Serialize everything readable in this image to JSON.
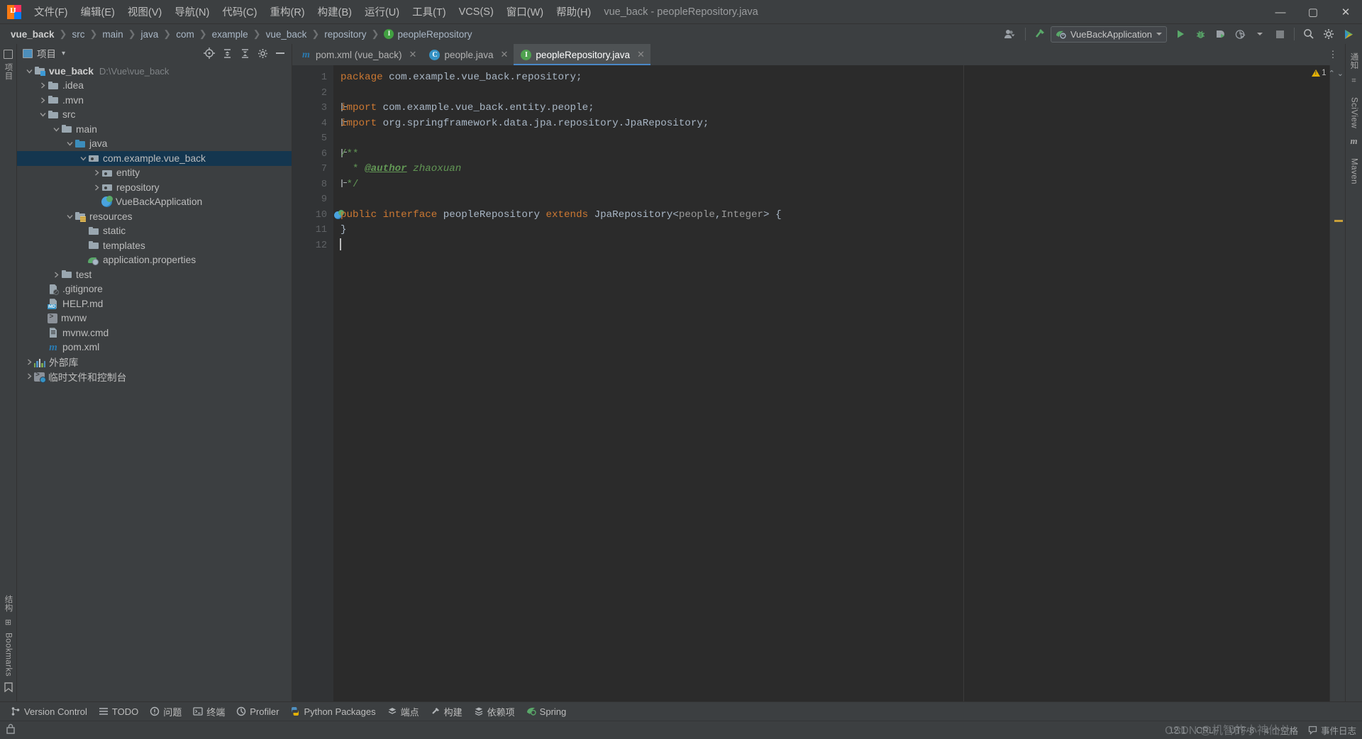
{
  "window": {
    "title": "vue_back - peopleRepository.java",
    "logo_text": "IJ",
    "minimize": "—",
    "maximize": "▢",
    "close": "✕"
  },
  "menu": [
    {
      "label": "文件(F)",
      "name": "menu-file"
    },
    {
      "label": "编辑(E)",
      "name": "menu-edit"
    },
    {
      "label": "视图(V)",
      "name": "menu-view"
    },
    {
      "label": "导航(N)",
      "name": "menu-navigate"
    },
    {
      "label": "代码(C)",
      "name": "menu-code"
    },
    {
      "label": "重构(R)",
      "name": "menu-refactor"
    },
    {
      "label": "构建(B)",
      "name": "menu-build"
    },
    {
      "label": "运行(U)",
      "name": "menu-run"
    },
    {
      "label": "工具(T)",
      "name": "menu-tools"
    },
    {
      "label": "VCS(S)",
      "name": "menu-vcs"
    },
    {
      "label": "窗口(W)",
      "name": "menu-window"
    },
    {
      "label": "帮助(H)",
      "name": "menu-help"
    }
  ],
  "breadcrumb": {
    "separator": "❯",
    "items": [
      "vue_back",
      "src",
      "main",
      "java",
      "com",
      "example",
      "vue_back",
      "repository",
      "peopleRepository"
    ],
    "last_icon": "I"
  },
  "toolbar": {
    "account_icon": "user-dropdown",
    "build_icon": "hammer-icon",
    "run_config": "VueBackApplication",
    "run_label": "run-button",
    "debug_label": "debug-button",
    "coverage_label": "coverage-button",
    "profiler_label": "profiler-button",
    "stop_label": "stop-button",
    "search_icon": "🔍",
    "settings_icon": "⚙",
    "updates_icon": "updates-icon"
  },
  "left_strip": {
    "project_vtext": "项目",
    "structure_vtext": "结构",
    "bookmarks_vtext": "Bookmarks"
  },
  "right_strip": {
    "notifications_vtext": "通知",
    "sciview_vtext": "SciView",
    "maven_vtext": "Maven",
    "maven_glyph": "m"
  },
  "project_panel": {
    "title": "项目",
    "dropdown": "▾",
    "actions": [
      "select-opened-file-icon",
      "expand-all-icon",
      "collapse-all-icon",
      "settings-icon",
      "hide-icon"
    ],
    "tree": [
      {
        "label": "vue_back",
        "path": "D:\\Vue\\vue_back",
        "indent": 0,
        "twisty": "expanded",
        "icon": "module",
        "bold": true,
        "selected": false
      },
      {
        "label": ".idea",
        "indent": 1,
        "twisty": "collapsed",
        "icon": "folder",
        "selected": false
      },
      {
        "label": ".mvn",
        "indent": 1,
        "twisty": "collapsed",
        "icon": "folder",
        "selected": false
      },
      {
        "label": "src",
        "indent": 1,
        "twisty": "expanded",
        "icon": "folder",
        "selected": false
      },
      {
        "label": "main",
        "indent": 2,
        "twisty": "expanded",
        "icon": "folder",
        "selected": false
      },
      {
        "label": "java",
        "indent": 3,
        "twisty": "expanded",
        "icon": "folder-src",
        "selected": false
      },
      {
        "label": "com.example.vue_back",
        "indent": 4,
        "twisty": "expanded",
        "icon": "package",
        "selected": true
      },
      {
        "label": "entity",
        "indent": 5,
        "twisty": "collapsed",
        "icon": "package",
        "selected": false
      },
      {
        "label": "repository",
        "indent": 5,
        "twisty": "collapsed",
        "icon": "package",
        "selected": false
      },
      {
        "label": "VueBackApplication",
        "indent": 5,
        "twisty": "none",
        "icon": "spring-app",
        "selected": false
      },
      {
        "label": "resources",
        "indent": 3,
        "twisty": "expanded",
        "icon": "folder-resource",
        "selected": false
      },
      {
        "label": "static",
        "indent": 4,
        "twisty": "none",
        "icon": "folder",
        "selected": false
      },
      {
        "label": "templates",
        "indent": 4,
        "twisty": "none",
        "icon": "folder",
        "selected": false
      },
      {
        "label": "application.properties",
        "indent": 4,
        "twisty": "none",
        "icon": "spring-leaf",
        "selected": false
      },
      {
        "label": "test",
        "indent": 2,
        "twisty": "collapsed",
        "icon": "folder",
        "selected": false
      },
      {
        "label": ".gitignore",
        "indent": 1,
        "twisty": "none",
        "icon": "gitignore-file",
        "selected": false
      },
      {
        "label": "HELP.md",
        "indent": 1,
        "twisty": "none",
        "icon": "markdown-file",
        "selected": false
      },
      {
        "label": "mvnw",
        "indent": 1,
        "twisty": "none",
        "icon": "script-file",
        "selected": false
      },
      {
        "label": "mvnw.cmd",
        "indent": 1,
        "twisty": "none",
        "icon": "cmd-file",
        "selected": false
      },
      {
        "label": "pom.xml",
        "indent": 1,
        "twisty": "none",
        "icon": "maven-file",
        "selected": false
      },
      {
        "label": "外部库",
        "indent": 0,
        "twisty": "collapsed",
        "icon": "libraries",
        "selected": false
      },
      {
        "label": "临时文件和控制台",
        "indent": 0,
        "twisty": "collapsed",
        "icon": "scratches",
        "selected": false
      }
    ]
  },
  "tabs": [
    {
      "label": "pom.xml (vue_back)",
      "icon": "maven",
      "icon_text": "m",
      "active": false,
      "close": "✕"
    },
    {
      "label": "people.java",
      "icon": "class",
      "icon_text": "C",
      "active": false,
      "close": "✕"
    },
    {
      "label": "peopleRepository.java",
      "icon": "interface",
      "icon_text": "I",
      "active": true,
      "close": "✕"
    }
  ],
  "tabs_right": {
    "more_icon": "⋮"
  },
  "editor": {
    "line_numbers": [
      "1",
      "2",
      "3",
      "4",
      "5",
      "6",
      "7",
      "8",
      "9",
      "10",
      "11",
      "12"
    ],
    "lines": [
      {
        "n": 1,
        "tokens": [
          {
            "t": "package ",
            "c": "kw"
          },
          {
            "t": "com.example.vue_back.repository;",
            "c": "ident"
          }
        ]
      },
      {
        "n": 2,
        "tokens": []
      },
      {
        "n": 3,
        "fold": "start-round",
        "tokens": [
          {
            "t": "import ",
            "c": "kw"
          },
          {
            "t": "com.example.vue_back.entity.people;",
            "c": "ident"
          }
        ]
      },
      {
        "n": 4,
        "fold": "end",
        "tokens": [
          {
            "t": "import ",
            "c": "kw"
          },
          {
            "t": "org.springframework.data.jpa.repository.JpaRepository;",
            "c": "ident"
          }
        ]
      },
      {
        "n": 5,
        "tokens": []
      },
      {
        "n": 6,
        "fold": "start-round",
        "tokens": [
          {
            "t": "/**",
            "c": "cmt"
          }
        ]
      },
      {
        "n": 7,
        "tokens": [
          {
            "t": "  * ",
            "c": "cmt"
          },
          {
            "t": "@author",
            "c": "cmt-tag"
          },
          {
            "t": " zhaoxuan",
            "c": "cmt-it"
          }
        ]
      },
      {
        "n": 8,
        "fold": "end",
        "tokens": [
          {
            "t": " */",
            "c": "cmt"
          }
        ]
      },
      {
        "n": 9,
        "tokens": []
      },
      {
        "n": 10,
        "runmark": true,
        "tokens": [
          {
            "t": "public ",
            "c": "kw"
          },
          {
            "t": "interface ",
            "c": "kw"
          },
          {
            "t": "peopleRepository ",
            "c": "ident"
          },
          {
            "t": "extends ",
            "c": "kw"
          },
          {
            "t": "JpaRepository",
            "c": "ident"
          },
          {
            "t": "<",
            "c": "ident"
          },
          {
            "t": "people",
            "c": "type-gray"
          },
          {
            "t": ",",
            "c": "ident"
          },
          {
            "t": "Integer",
            "c": "type-gray"
          },
          {
            "t": "> {",
            "c": "ident"
          }
        ]
      },
      {
        "n": 11,
        "tokens": [
          {
            "t": "}",
            "c": "ident"
          }
        ]
      },
      {
        "n": 12,
        "caret": true,
        "tokens": []
      }
    ]
  },
  "inspection": {
    "warning_count": "1",
    "warning_icon": "warning-triangle",
    "up_icon": "⌃",
    "down_icon": "⌄"
  },
  "bottom_tools": [
    {
      "label": "Version Control",
      "icon": "branch-icon",
      "name": "tool-version-control"
    },
    {
      "label": "TODO",
      "icon": "list-icon",
      "name": "tool-todo"
    },
    {
      "label": "问题",
      "icon": "problems-icon",
      "name": "tool-problems"
    },
    {
      "label": "终端",
      "icon": "terminal-icon",
      "name": "tool-terminal"
    },
    {
      "label": "Profiler",
      "icon": "profiler-icon",
      "name": "tool-profiler"
    },
    {
      "label": "Python Packages",
      "icon": "python-icon",
      "name": "tool-python-packages"
    },
    {
      "label": "端点",
      "icon": "endpoints-icon",
      "name": "tool-endpoints"
    },
    {
      "label": "构建",
      "icon": "build-icon",
      "name": "tool-build"
    },
    {
      "label": "依赖项",
      "icon": "dependencies-icon",
      "name": "tool-dependencies"
    },
    {
      "label": "Spring",
      "icon": "spring-icon",
      "name": "tool-spring"
    }
  ],
  "status": {
    "caret_position": "12:1",
    "line_separator": "CRLF",
    "encoding": "UTF-8",
    "indent": "4 个空格",
    "readonly_icon": "lock-icon",
    "event_log": "事件日志",
    "event_log_icon": "balloon-icon",
    "watermark": "CSDN @机智的小神仙儿"
  },
  "colors": {
    "accent_blue": "#4a88c7",
    "selection": "#14364f",
    "keyword_orange": "#cc7832",
    "comment_green": "#629755",
    "identifier": "#a9b7c6",
    "editor_bg": "#2b2b2b",
    "panel_bg": "#3c3f41",
    "spring_green": "#59a869",
    "warning_yellow": "#e2b007"
  }
}
